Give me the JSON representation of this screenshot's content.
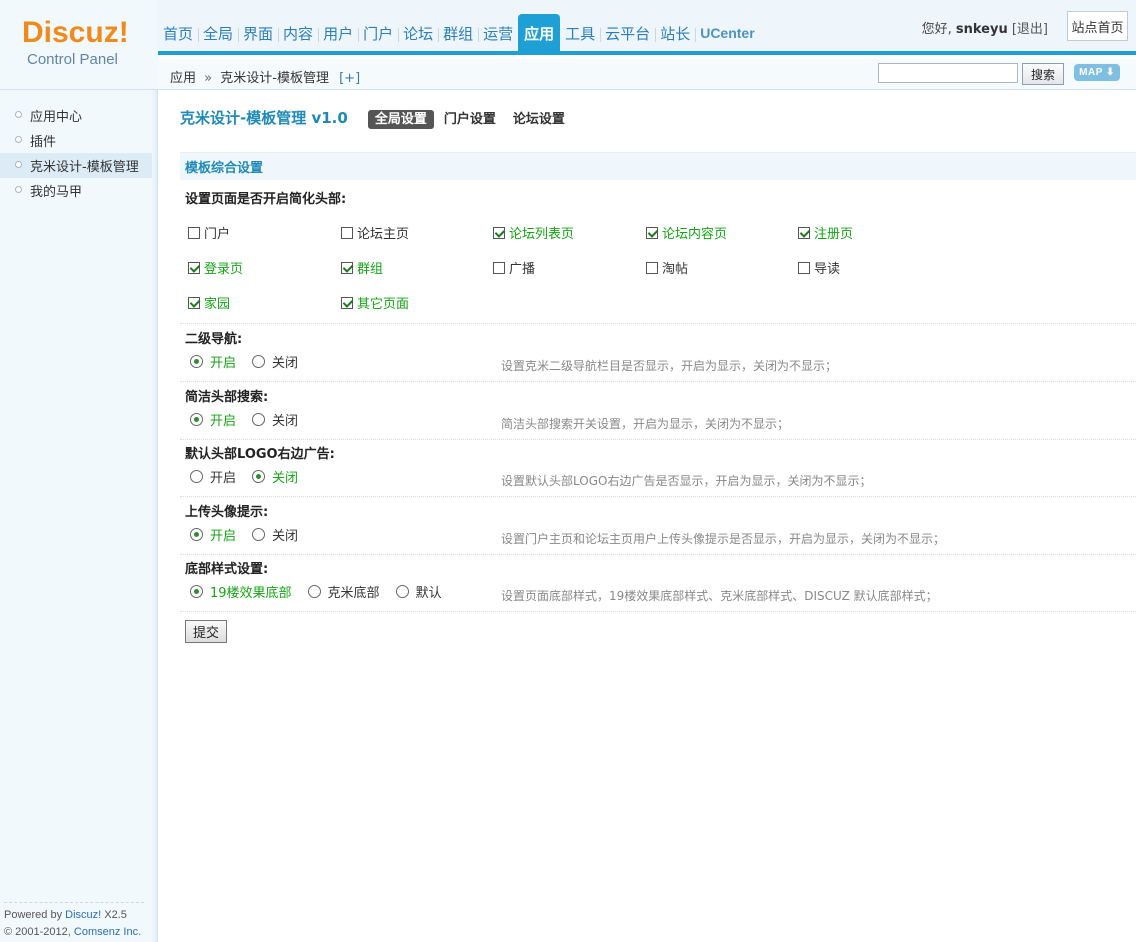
{
  "logo": {
    "brand": "Discuz!",
    "subtitle": "Control Panel"
  },
  "nav": {
    "items": [
      "首页",
      "全局",
      "界面",
      "内容",
      "用户",
      "门户",
      "论坛",
      "群组",
      "运营",
      "应用",
      "工具",
      "云平台",
      "站长",
      "UCenter"
    ],
    "active": "应用"
  },
  "user": {
    "greeting": "您好,",
    "name": "snkeyu",
    "logout": "[退出]",
    "home_button": "站点首页"
  },
  "breadcrumb": {
    "root": "应用",
    "separator": "»",
    "current": "克米设计-模板管理",
    "add": "[+]"
  },
  "search": {
    "value": "",
    "button": "搜索",
    "map_button": "MAP ⬇"
  },
  "sidebar": {
    "items": [
      {
        "label": "应用中心",
        "active": false
      },
      {
        "label": "插件",
        "active": false
      },
      {
        "label": "克米设计-模板管理",
        "active": true
      },
      {
        "label": "我的马甲",
        "active": false
      }
    ],
    "powered": {
      "prefix": "Powered by",
      "product": "Discuz!",
      "version": "X2.5",
      "copy": "© 2001-2012,",
      "company": "Comsenz Inc."
    }
  },
  "page": {
    "title": "克米设计-模板管理 v1.0",
    "tabs": [
      {
        "label": "全局设置",
        "active": true
      },
      {
        "label": "门户设置",
        "active": false
      },
      {
        "label": "论坛设置",
        "active": false
      }
    ],
    "section_title": "模板综合设置"
  },
  "simplified_header": {
    "label": "设置页面是否开启简化头部:",
    "options": [
      {
        "label": "门户",
        "checked": false
      },
      {
        "label": "论坛主页",
        "checked": false
      },
      {
        "label": "论坛列表页",
        "checked": true
      },
      {
        "label": "论坛内容页",
        "checked": true
      },
      {
        "label": "注册页",
        "checked": true
      },
      {
        "label": "登录页",
        "checked": true
      },
      {
        "label": "群组",
        "checked": true
      },
      {
        "label": "广播",
        "checked": false
      },
      {
        "label": "淘帖",
        "checked": false
      },
      {
        "label": "导读",
        "checked": false
      },
      {
        "label": "家园",
        "checked": true
      },
      {
        "label": "其它页面",
        "checked": true
      }
    ]
  },
  "settings": [
    {
      "label": "二级导航:",
      "options": [
        "开启",
        "关闭"
      ],
      "selected": 0,
      "tip": "设置克米二级导航栏目是否显示，开启为显示，关闭为不显示；"
    },
    {
      "label": "简洁头部搜索:",
      "options": [
        "开启",
        "关闭"
      ],
      "selected": 0,
      "tip": "简洁头部搜索开关设置，开启为显示，关闭为不显示；"
    },
    {
      "label": "默认头部LOGO右边广告:",
      "options": [
        "开启",
        "关闭"
      ],
      "selected": 1,
      "tip": "设置默认头部LOGO右边广告是否显示，开启为显示，关闭为不显示；"
    },
    {
      "label": "上传头像提示:",
      "options": [
        "开启",
        "关闭"
      ],
      "selected": 0,
      "tip": "设置门户主页和论坛主页用户上传头像提示是否显示，开启为显示，关闭为不显示；"
    },
    {
      "label": "底部样式设置:",
      "options": [
        "19楼效果底部",
        "克米底部",
        "默认"
      ],
      "selected": 0,
      "tip": "设置页面底部样式，19楼效果底部样式、克米底部样式、DISCUZ 默认底部样式；"
    }
  ],
  "submit_label": "提交"
}
